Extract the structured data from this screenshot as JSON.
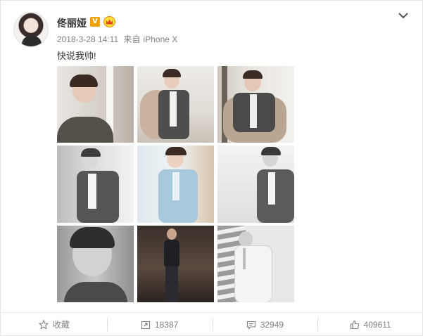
{
  "post": {
    "username": "佟丽娅",
    "verified_badge": "V",
    "timestamp": "2018-3-28 14:11",
    "source_prefix": "来自",
    "source": "iPhone X",
    "text": "快说我帅!"
  },
  "photos": [
    {
      "name": "photo-1",
      "tone": "color"
    },
    {
      "name": "photo-2",
      "tone": "color"
    },
    {
      "name": "photo-3",
      "tone": "color"
    },
    {
      "name": "photo-4",
      "tone": "monochrome"
    },
    {
      "name": "photo-5",
      "tone": "color"
    },
    {
      "name": "photo-6",
      "tone": "monochrome"
    },
    {
      "name": "photo-7",
      "tone": "monochrome"
    },
    {
      "name": "photo-8",
      "tone": "color"
    },
    {
      "name": "photo-9",
      "tone": "monochrome"
    }
  ],
  "actions": {
    "favorite": {
      "label": "收藏",
      "icon": "star-icon"
    },
    "repost": {
      "count": "18387",
      "icon": "repost-icon"
    },
    "comment": {
      "count": "32949",
      "icon": "comment-icon"
    },
    "like": {
      "count": "409611",
      "icon": "thumbs-up-icon"
    }
  },
  "colors": {
    "text": "#333333",
    "meta": "#808080",
    "badge": "#f0a000",
    "divider": "#eeeeee"
  }
}
